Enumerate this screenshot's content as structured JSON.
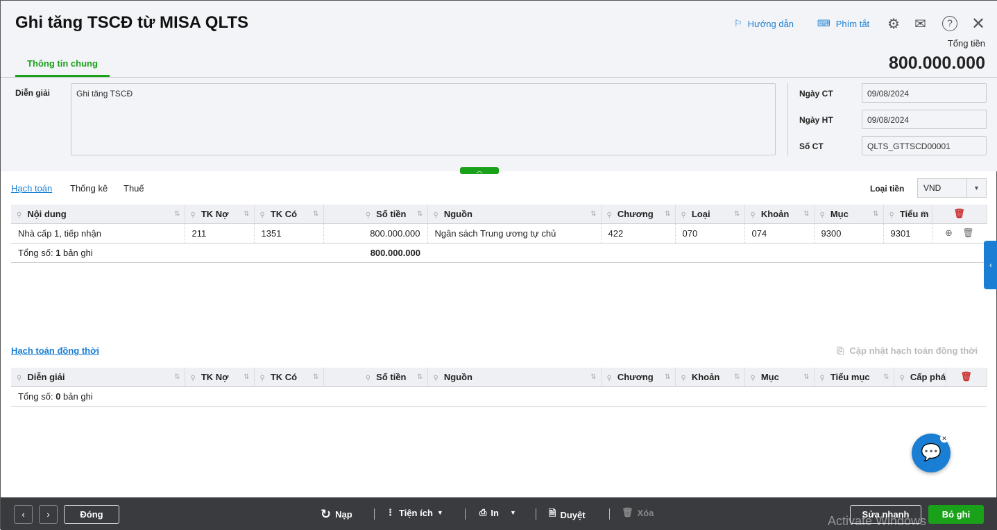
{
  "header": {
    "title": "Ghi tăng TSCĐ từ MISA QLTS",
    "guide": "Hướng dẫn",
    "shortcuts": "Phím tắt",
    "total_label": "Tổng tiền",
    "total_value": "800.000.000"
  },
  "tabs": {
    "general": "Thông tin chung"
  },
  "form": {
    "desc_label": "Diễn giải",
    "desc_value": "Ghi tăng TSCĐ",
    "ngay_ct_label": "Ngày CT",
    "ngay_ct": "09/08/2024",
    "ngay_ht_label": "Ngày HT",
    "ngay_ht": "09/08/2024",
    "so_ct_label": "Số CT",
    "so_ct": "QLTS_GTTSCD00001"
  },
  "subtabs": [
    "Hạch toán",
    "Thống kê",
    "Thuế"
  ],
  "currency": {
    "label": "Loại tiền",
    "value": "VND"
  },
  "grid1": {
    "columns": [
      "Nội dung",
      "TK Nợ",
      "TK Có",
      "Số tiền",
      "Nguồn",
      "Chương",
      "Loại",
      "Khoản",
      "Mục",
      "Tiểu m"
    ],
    "rows": [
      [
        "Nhà cấp 1, tiếp nhận",
        "211",
        "1351",
        "800.000.000",
        "Ngân sách Trung ương tự chủ",
        "422",
        "070",
        "074",
        "9300",
        "9301"
      ]
    ],
    "footer_prefix": "Tổng số: ",
    "footer_count": "1",
    "footer_suffix": " bản ghi",
    "footer_total": "800.000.000"
  },
  "section2": {
    "title": "Hạch toán đồng thời",
    "update": "Cập nhật hạch toán đồng thời"
  },
  "grid2": {
    "columns": [
      "Diễn giải",
      "TK Nợ",
      "TK Có",
      "Số tiền",
      "Nguồn",
      "Chương",
      "Khoản",
      "Mục",
      "Tiểu mục",
      "Cấp phá"
    ],
    "footer_prefix": "Tổng số: ",
    "footer_count": "0",
    "footer_suffix": " bản ghi"
  },
  "toolbar": {
    "close": "Đóng",
    "reload": "Nạp",
    "utilities": "Tiện ích",
    "print": "In",
    "approve": "Duyệt",
    "delete": "Xóa",
    "quick_edit": "Sửa nhanh",
    "unpost": "Bỏ ghi"
  },
  "watermark": "Activate Windows"
}
